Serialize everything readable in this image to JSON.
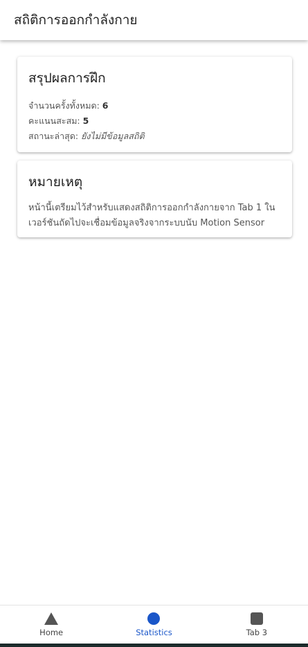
{
  "header": {
    "title": "สถิติการออกกำลังกาย"
  },
  "summary": {
    "title": "สรุปผลการฝึก",
    "total_label": "จำนวนครั้งทั้งหมด:",
    "total_value": "6",
    "score_label": "คะแนนสะสม:",
    "score_value": "5",
    "status_label": "สถานะล่าสุด:",
    "status_value": "ยังไม่มีข้อมูลสถิติ"
  },
  "note": {
    "title": "หมายเหตุ",
    "text": "หน้านี้เตรียมไว้สำหรับแสดงสถิติการออกกำลังกายจาก Tab 1 ในเวอร์ชันถัดไปจะเชื่อมข้อมูลจริงจากระบบนับ Motion Sensor"
  },
  "tabs": [
    {
      "label": "Home",
      "icon": "triangle-icon",
      "active": false
    },
    {
      "label": "Statistics",
      "icon": "circle-icon",
      "active": true
    },
    {
      "label": "Tab 3",
      "icon": "square-icon",
      "active": false
    }
  ],
  "colors": {
    "accent": "#1a56c9",
    "icon_inactive": "#555555"
  }
}
